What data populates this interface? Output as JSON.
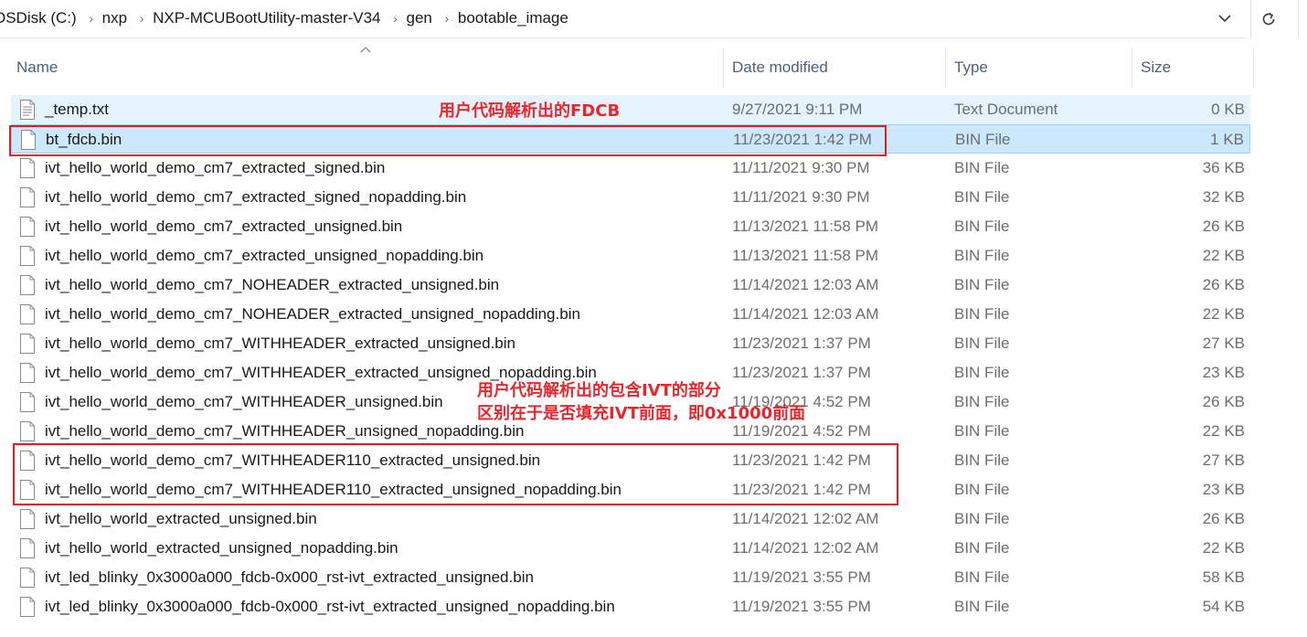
{
  "breadcrumb": {
    "items": [
      "OSDisk (C:)",
      "nxp",
      "NXP-MCUBootUtility-master-V34",
      "gen",
      "bootable_image"
    ]
  },
  "columns": {
    "name": "Name",
    "date": "Date modified",
    "type": "Type",
    "size": "Size"
  },
  "files": [
    {
      "name": "_temp.txt",
      "date": "9/27/2021 9:11 PM",
      "type": "Text Document",
      "size": "0 KB",
      "icon": "text-document-icon"
    },
    {
      "name": "bt_fdcb.bin",
      "date": "11/23/2021 1:42 PM",
      "type": "BIN File",
      "size": "1 KB",
      "icon": "file-icon"
    },
    {
      "name": "ivt_hello_world_demo_cm7_extracted_signed.bin",
      "date": "11/11/2021 9:30 PM",
      "type": "BIN File",
      "size": "36 KB",
      "icon": "file-icon"
    },
    {
      "name": "ivt_hello_world_demo_cm7_extracted_signed_nopadding.bin",
      "date": "11/11/2021 9:30 PM",
      "type": "BIN File",
      "size": "32 KB",
      "icon": "file-icon"
    },
    {
      "name": "ivt_hello_world_demo_cm7_extracted_unsigned.bin",
      "date": "11/13/2021 11:58 PM",
      "type": "BIN File",
      "size": "26 KB",
      "icon": "file-icon"
    },
    {
      "name": "ivt_hello_world_demo_cm7_extracted_unsigned_nopadding.bin",
      "date": "11/13/2021 11:58 PM",
      "type": "BIN File",
      "size": "22 KB",
      "icon": "file-icon"
    },
    {
      "name": "ivt_hello_world_demo_cm7_NOHEADER_extracted_unsigned.bin",
      "date": "11/14/2021 12:03 AM",
      "type": "BIN File",
      "size": "26 KB",
      "icon": "file-icon"
    },
    {
      "name": "ivt_hello_world_demo_cm7_NOHEADER_extracted_unsigned_nopadding.bin",
      "date": "11/14/2021 12:03 AM",
      "type": "BIN File",
      "size": "22 KB",
      "icon": "file-icon"
    },
    {
      "name": "ivt_hello_world_demo_cm7_WITHHEADER_extracted_unsigned.bin",
      "date": "11/23/2021 1:37 PM",
      "type": "BIN File",
      "size": "27 KB",
      "icon": "file-icon"
    },
    {
      "name": "ivt_hello_world_demo_cm7_WITHHEADER_extracted_unsigned_nopadding.bin",
      "date": "11/23/2021 1:37 PM",
      "type": "BIN File",
      "size": "23 KB",
      "icon": "file-icon"
    },
    {
      "name": "ivt_hello_world_demo_cm7_WITHHEADER_unsigned.bin",
      "date": "11/19/2021 4:52 PM",
      "type": "BIN File",
      "size": "26 KB",
      "icon": "file-icon"
    },
    {
      "name": "ivt_hello_world_demo_cm7_WITHHEADER_unsigned_nopadding.bin",
      "date": "11/19/2021 4:52 PM",
      "type": "BIN File",
      "size": "22 KB",
      "icon": "file-icon"
    },
    {
      "name": "ivt_hello_world_demo_cm7_WITHHEADER110_extracted_unsigned.bin",
      "date": "11/23/2021 1:42 PM",
      "type": "BIN File",
      "size": "27 KB",
      "icon": "file-icon"
    },
    {
      "name": "ivt_hello_world_demo_cm7_WITHHEADER110_extracted_unsigned_nopadding.bin",
      "date": "11/23/2021 1:42 PM",
      "type": "BIN File",
      "size": "23 KB",
      "icon": "file-icon"
    },
    {
      "name": "ivt_hello_world_extracted_unsigned.bin",
      "date": "11/14/2021 12:02 AM",
      "type": "BIN File",
      "size": "26 KB",
      "icon": "file-icon"
    },
    {
      "name": "ivt_hello_world_extracted_unsigned_nopadding.bin",
      "date": "11/14/2021 12:02 AM",
      "type": "BIN File",
      "size": "22 KB",
      "icon": "file-icon"
    },
    {
      "name": "ivt_led_blinky_0x3000a000_fdcb-0x000_rst-ivt_extracted_unsigned.bin",
      "date": "11/19/2021 3:55 PM",
      "type": "BIN File",
      "size": "58 KB",
      "icon": "file-icon"
    },
    {
      "name": "ivt_led_blinky_0x3000a000_fdcb-0x000_rst-ivt_extracted_unsigned_nopadding.bin",
      "date": "11/19/2021 3:55 PM",
      "type": "BIN File",
      "size": "54 KB",
      "icon": "file-icon"
    }
  ],
  "annotations": {
    "fdcb_note": "用户代码解析出的FDCB",
    "ivt_note_line1": "用户代码解析出的包含IVT的部分",
    "ivt_note_line2": "区别在于是否填充IVT前面，即0x1000前面",
    "color": "#e21b1b"
  },
  "colors": {
    "hover_row": "#e5f3ff",
    "selected_row": "#cce8ff",
    "selected_border": "#99d1ff",
    "header_text": "#4c607a",
    "meta_text": "#6d6d6d"
  }
}
